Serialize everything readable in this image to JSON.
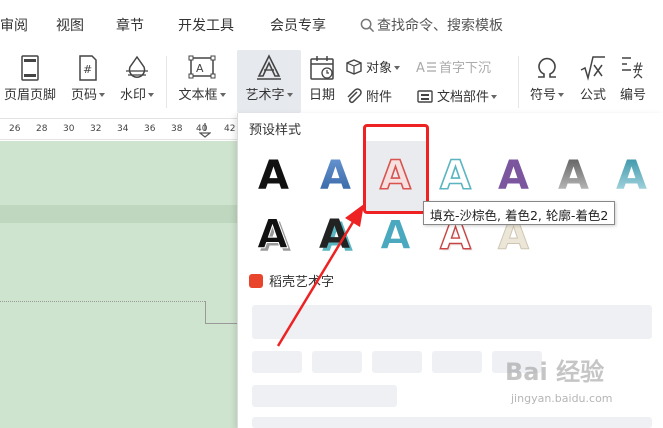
{
  "menu": {
    "items": [
      "审阅",
      "视图",
      "章节",
      "开发工具",
      "会员专享"
    ],
    "search": "查找命令、搜索模板"
  },
  "ribbon": {
    "header_footer": "页眉页脚",
    "page_number": "页码",
    "watermark": "水印",
    "textbox": "文本框",
    "wordart": "艺术字",
    "date": "日期",
    "object": "对象",
    "attachment": "附件",
    "dropcap": "首字下沉",
    "doc_parts": "文档部件",
    "symbol": "符号",
    "formula": "公式",
    "numbering": "编号"
  },
  "ruler": {
    "ticks": [
      "26",
      "28",
      "30",
      "32",
      "34",
      "36",
      "38",
      "40",
      "42"
    ]
  },
  "panel": {
    "preset_title": "预设样式",
    "tooltip": "填充-沙棕色, 着色2, 轮廓-着色2",
    "section2_title": "稻壳艺术字",
    "glyph": "A",
    "row1": [
      {
        "name": "black-fill",
        "fill": "#111111",
        "stroke": "none"
      },
      {
        "name": "blue-gradient",
        "fill": "#4a7fc4",
        "stroke": "none"
      },
      {
        "name": "sand-fill-accent2",
        "fill": "#f4dede",
        "stroke": "#d9534f"
      },
      {
        "name": "teal-outline",
        "fill": "#ffffff",
        "stroke": "#5ab5c0"
      },
      {
        "name": "purple-fill",
        "fill": "#7b559e",
        "stroke": "none"
      },
      {
        "name": "gray-gradient",
        "fill": "#8a8a8a",
        "stroke": "none"
      },
      {
        "name": "teal-gradient",
        "fill": "#3e9fb0",
        "stroke": "none"
      }
    ],
    "row2": [
      {
        "name": "black-3d",
        "fill": "#111111",
        "stroke": "#ffffff"
      },
      {
        "name": "black-teal-shadow",
        "fill": "#222222",
        "stroke": "#ffffff"
      },
      {
        "name": "teal-3d",
        "fill": "#4aa8bf",
        "stroke": "#ffffff"
      },
      {
        "name": "red-outline-3d",
        "fill": "#ffffff",
        "stroke": "#c94444"
      },
      {
        "name": "beige-faded",
        "fill": "#e9e2d2",
        "stroke": "#cfc6b2"
      }
    ]
  },
  "watermark": {
    "main": "Bai 经验",
    "sub": "jingyan.baidu.com"
  },
  "colors": {
    "highlight_red": "#ee2222",
    "doc_green": "#cfe4cf"
  }
}
